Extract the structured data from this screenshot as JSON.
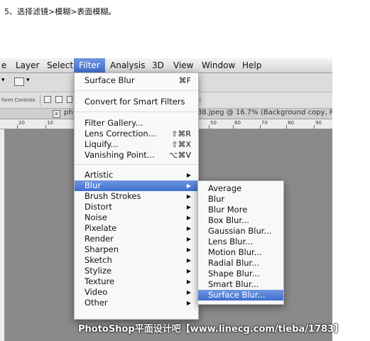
{
  "caption": "5、选择滤镜>模糊>表面模糊。",
  "menubar": {
    "items": [
      "e",
      "Layer",
      "Select",
      "Filter",
      "Analysis",
      "3D",
      "View",
      "Window",
      "Help"
    ],
    "active": "Filter"
  },
  "toolbar2": {
    "label": "form Controls"
  },
  "doc_tab": {
    "left_text": "ph",
    "right_text": "38.jpeg @ 16.7% (Background copy, R"
  },
  "ruler": {
    "ticks": [
      "20",
      "10",
      "50",
      "60",
      "70",
      "80",
      "90"
    ]
  },
  "filter_menu": {
    "last_filter": {
      "label": "Surface Blur",
      "shortcut": "⌘F"
    },
    "convert": "Convert for Smart Filters",
    "gallery_items": [
      {
        "label": "Filter Gallery...",
        "shortcut": ""
      },
      {
        "label": "Lens Correction...",
        "shortcut": "⇧⌘R"
      },
      {
        "label": "Liquify...",
        "shortcut": "⇧⌘X"
      },
      {
        "label": "Vanishing Point...",
        "shortcut": "⌥⌘V"
      }
    ],
    "categories": [
      "Artistic",
      "Blur",
      "Brush Strokes",
      "Distort",
      "Noise",
      "Pixelate",
      "Render",
      "Sharpen",
      "Sketch",
      "Stylize",
      "Texture",
      "Video",
      "Other"
    ],
    "highlighted": "Blur"
  },
  "blur_submenu": {
    "items": [
      "Average",
      "Blur",
      "Blur More",
      "Box Blur...",
      "Gaussian Blur...",
      "Lens Blur...",
      "Motion Blur...",
      "Radial Blur...",
      "Shape Blur...",
      "Smart Blur...",
      "Surface Blur..."
    ],
    "highlighted": "Surface Blur..."
  },
  "watermark": "PhotoShop平面设计吧【www.linecg.com/tieba/1783】",
  "colors": {
    "highlight": "#4a78d6",
    "canvas": "#8a8a8a"
  }
}
